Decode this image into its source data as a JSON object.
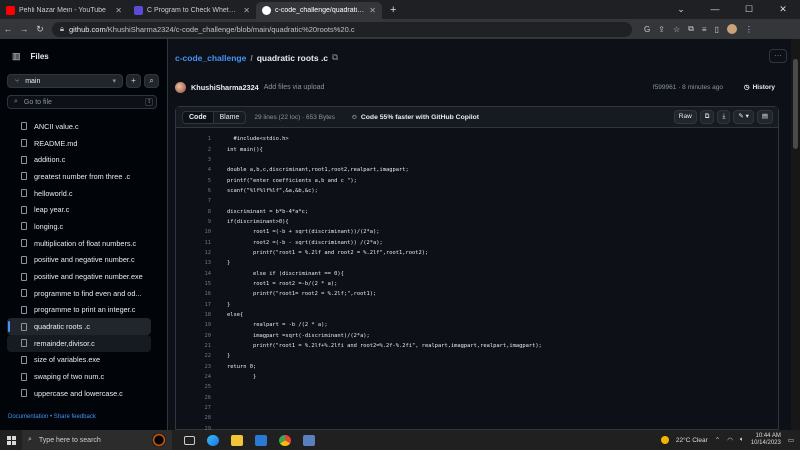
{
  "browser": {
    "tabs": [
      {
        "title": "Pehli Nazar Mein - YouTube",
        "color": "#ff0000",
        "active": false
      },
      {
        "title": "C Program to Check Whether a",
        "color": "#5b4bd6",
        "active": false
      },
      {
        "title": "c-code_challenge/quadratic roo",
        "color": "#ffffff",
        "active": true
      }
    ],
    "new_tab": "+",
    "url_domain": "github.com",
    "url_path": "/KhushiSharma2324/c-code_challenge/blob/main/quadratic%20roots%20.c"
  },
  "sidebar": {
    "title": "Files",
    "branch": "main",
    "search_placeholder": "Go to file",
    "search_kbd": "t",
    "files": [
      "ANCII value.c",
      "README.md",
      "addition.c",
      "greatest number from three .c",
      "helloworld.c",
      "leap year.c",
      "longing.c",
      "multiplication of float numbers.c",
      "positive and negative number.c",
      "positive and negative number.exe",
      "programme to find even and od...",
      "programme to print an integer.c",
      "quadratic roots .c",
      "remainder,divisor.c",
      "size of variables.exe",
      "swaping of two num.c",
      "uppercase and lowercase.c"
    ],
    "selected_index": 12,
    "hover_index": 13,
    "footer_doc": "Documentation",
    "footer_sep": " • ",
    "footer_feedback": "Share feedback"
  },
  "breadcrumb": {
    "repo": "c-code_challenge",
    "sep": "/",
    "file": "quadratic roots .c"
  },
  "commit": {
    "author": "KhushiSharma2324",
    "message": "Add files via upload",
    "meta": "f599961 · 8 minutes ago",
    "history": "History"
  },
  "viewer": {
    "tab_code": "Code",
    "tab_blame": "Blame",
    "meta": "29 lines (22 loc) · 653 Bytes",
    "copilot": "Code 55% faster with GitHub Copilot",
    "raw": "Raw"
  },
  "code_lines": [
    "  #include<stdio.h>",
    "int main(){",
    "",
    "double a,b,c,discriminant,root1,root2,realpart,imagpart;",
    "printf(\"enter coefficients a,b and c \");",
    "scanf(\"%lf%lf%lf\",&a,&b,&c);",
    "",
    "discriminant = b*b-4*a*c;",
    "if(discriminant>0){",
    "        root1 =(-b + sqrt(discriminant))/(2*a);",
    "        root2 =(-b - sqrt(discriminant)) /(2*a);",
    "        printf(\"root1 = %.2lf and root2 = %.2lf\",root1,root2);",
    "}",
    "        else if (discriminant == 0){",
    "        root1 = root2 =-b/(2 * a);",
    "        printf(\"root1= root2 = %.2lf;\",root1);",
    "}",
    "else{",
    "        realpart = -b /(2 * a);",
    "        imagpart =sqrt(-discriminant)/(2*a);",
    "        printf(\"root1 = %.2lf+%.2lfi and root2=%.2f-%.2fi\", realpart,imagpart,realpart,imagpart);",
    "}",
    "return 0;",
    "        }",
    "",
    "",
    "",
    "",
    ""
  ],
  "taskbar": {
    "search_placeholder": "Type here to search",
    "weather": "22°C  Clear",
    "time": "10:44 AM",
    "date": "10/14/2023",
    "notif_count": "1"
  }
}
